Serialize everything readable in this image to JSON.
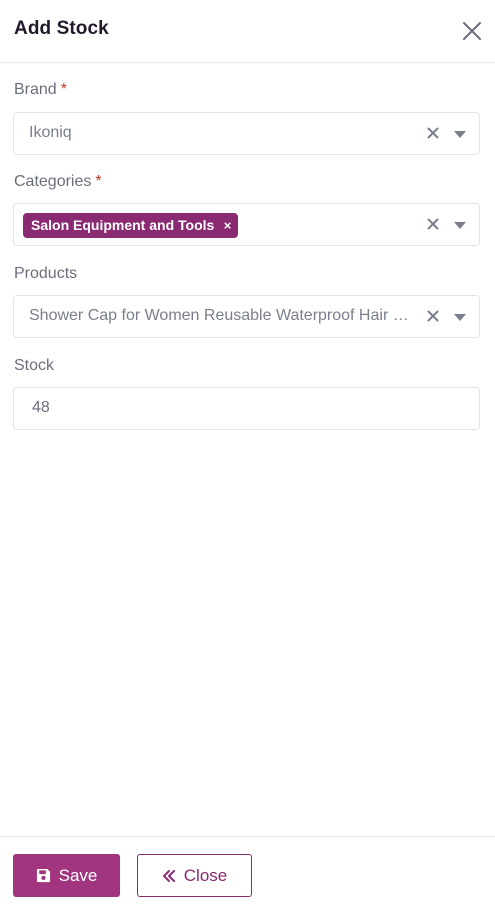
{
  "header": {
    "title": "Add Stock"
  },
  "form": {
    "brand": {
      "label": "Brand",
      "required_mark": "*",
      "value": "Ikoniq"
    },
    "categories": {
      "label": "Categories",
      "required_mark": "*",
      "chips": [
        "Salon Equipment and Tools"
      ],
      "chip_remove": "×"
    },
    "products": {
      "label": "Products",
      "value": "Shower Cap for Women Reusable Waterproof Hair Cap"
    },
    "stock": {
      "label": "Stock",
      "value": "48"
    }
  },
  "footer": {
    "save_label": "Save",
    "close_label": "Close"
  },
  "colors": {
    "accent": "#a1357f",
    "accent_dark": "#8a2a72",
    "required": "#c0392b"
  },
  "icons": {
    "header_close": "close-icon",
    "save": "floppy-disk-icon",
    "close": "double-chevron-left-icon",
    "clear": "clear-x-icon",
    "dropdown": "caret-down-icon"
  }
}
